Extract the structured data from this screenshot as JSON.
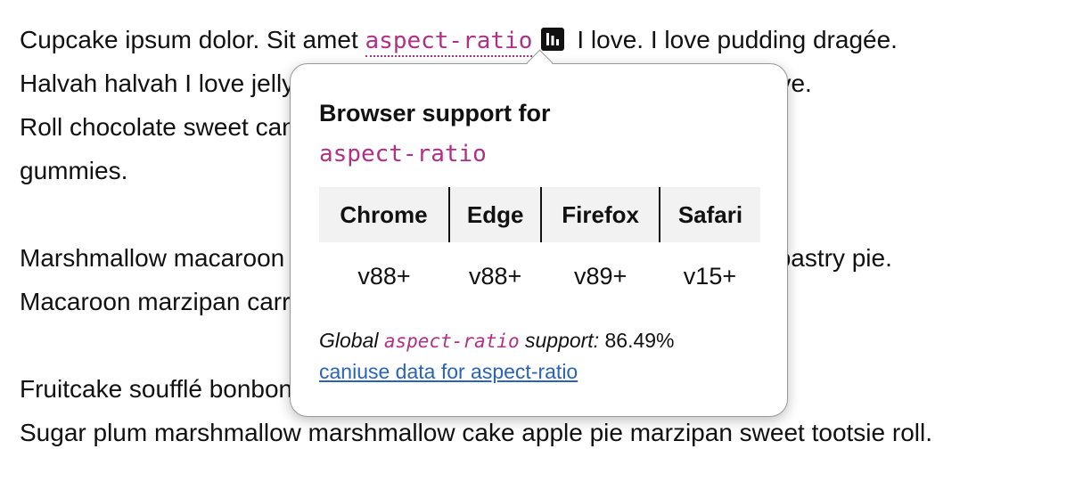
{
  "paragraphs": [
    {
      "lines": [
        {
          "before": "Cupcake ipsum dolor. Sit amet ",
          "term": "aspect-ratio",
          "after": "I love. I love pudding dragée."
        },
        {
          "text": "Halvah halvah I love jelly beans cookie cake gingerbread bonbon I love."
        },
        {
          "text": "Roll chocolate sweet candy canes jelly beans dragées cotton candy"
        },
        {
          "text": "gummies."
        }
      ]
    },
    {
      "lines": [
        {
          "text": "Marshmallow macaroon tiramisu gummi bears lemon drops pudding pastry pie."
        },
        {
          "text": "Macaroon marzipan carrot cake lollipop dessert oat cake."
        }
      ]
    },
    {
      "lines": [
        {
          "text": "Fruitcake soufflé bonbon jujubes toffee jelly beans ice cream bonbon."
        },
        {
          "text": "Sugar plum marshmallow marshmallow cake apple pie marzipan sweet tootsie roll."
        }
      ]
    }
  ],
  "chart_button": {
    "icon": "bar-chart-icon"
  },
  "popover": {
    "title": "Browser support for",
    "feature": "aspect-ratio",
    "table": {
      "headers": [
        "Chrome",
        "Edge",
        "Firefox",
        "Safari"
      ],
      "values": [
        "v88+",
        "v88+",
        "v89+",
        "v15+"
      ]
    },
    "global": {
      "prefix": "Global",
      "feature": "aspect-ratio",
      "suffix": "support:",
      "percent": "86.49%"
    },
    "link_text": "caniuse data for aspect-ratio"
  },
  "colors": {
    "term": "#b22f86",
    "link": "#2a63b8",
    "table_header_bg": "#f2f2f2"
  }
}
